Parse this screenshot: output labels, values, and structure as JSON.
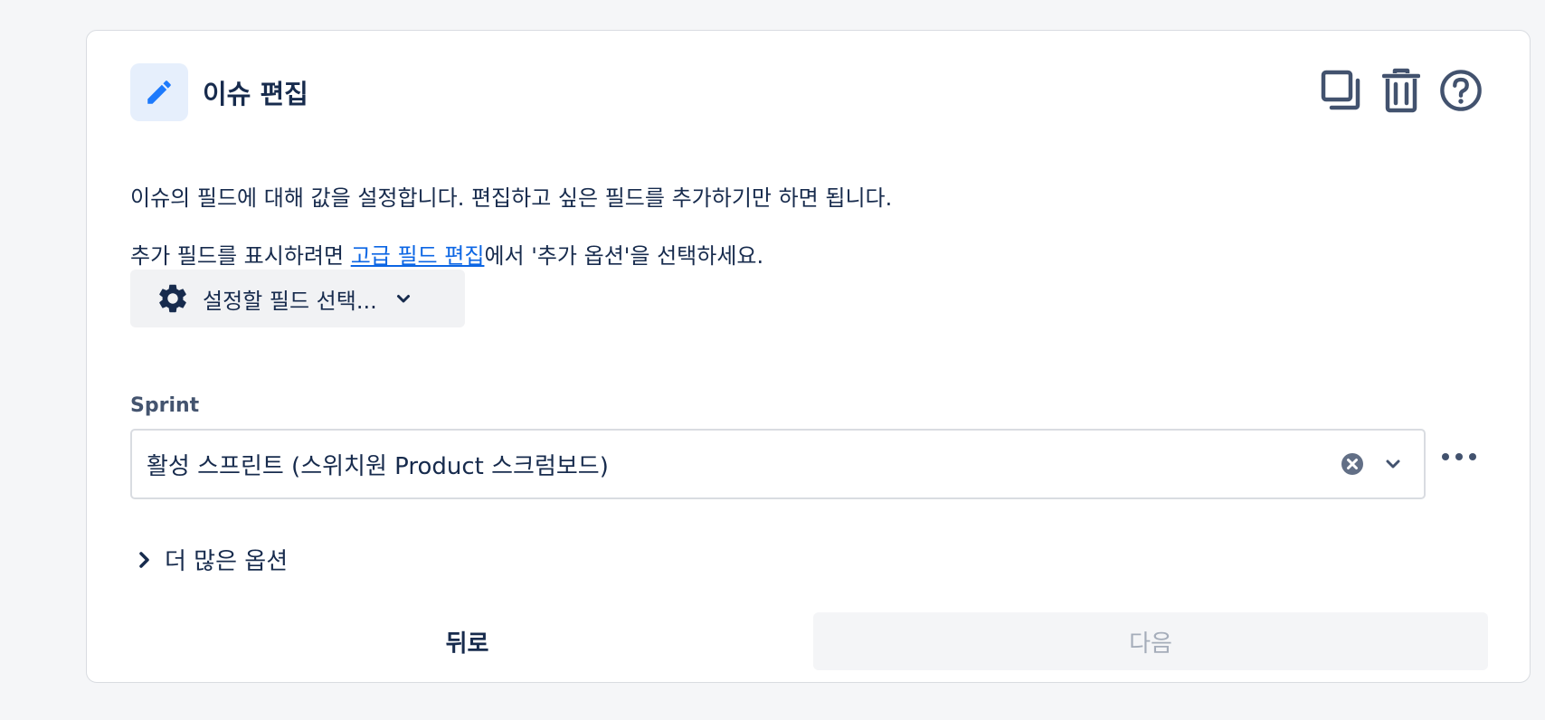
{
  "header": {
    "title": "이슈 편집",
    "icon": "pencil-icon"
  },
  "actions": {
    "duplicate_icon": "copy-icon",
    "delete_icon": "trash-icon",
    "help_icon": "help-icon"
  },
  "description": {
    "line1": "이슈의 필드에 대해 값을 설정합니다. 편집하고 싶은 필드를 추가하기만 하면 됩니다.",
    "line2_prefix": "추가 필드를 표시하려면 ",
    "line2_link": "고급 필드 편집",
    "line2_suffix": "에서 '추가 옵션'을 선택하세요."
  },
  "field_selector": {
    "label": "설정할 필드 선택...",
    "icon": "gear-icon"
  },
  "sprint_field": {
    "label": "Sprint",
    "value": "활성 스프린트 (스위치원 Product 스크럼보드)"
  },
  "more_options": {
    "label": "더 많은 옵션"
  },
  "footer": {
    "back_label": "뒤로",
    "next_label": "다음"
  },
  "colors": {
    "accent": "#0c66e4",
    "text": "#172b4d",
    "muted": "#44546f",
    "disabled_text": "#a5adba"
  }
}
